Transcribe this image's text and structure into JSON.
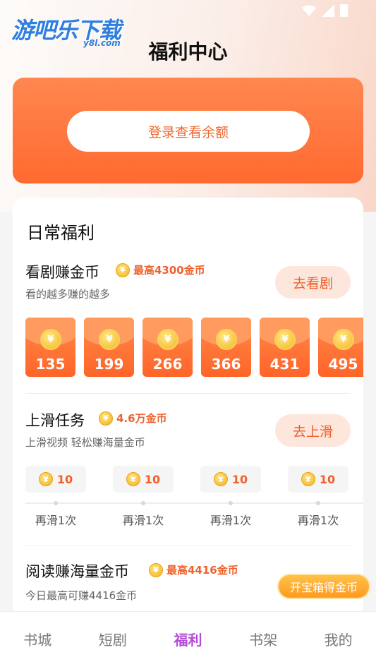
{
  "header": {
    "logo_text": "游吧乐下载",
    "logo_sub": "y8l.com",
    "title": "福利中心"
  },
  "balance": {
    "login_label": "登录查看余额"
  },
  "welfare": {
    "section_title": "日常福利",
    "coin_glyph": "¥",
    "drama_task": {
      "title": "看剧赚金币",
      "reward": "最高4300金币",
      "subtitle": "看的越多赚的越多",
      "button": "去看剧",
      "packets": [
        "135",
        "199",
        "266",
        "366",
        "431",
        "495"
      ]
    },
    "swipe_task": {
      "title": "上滑任务",
      "reward": "4.6万金币",
      "subtitle": "上滑视频 轻松赚海量金币",
      "button": "去上滑",
      "steps": [
        {
          "value": "10",
          "label": "再滑1次"
        },
        {
          "value": "10",
          "label": "再滑1次"
        },
        {
          "value": "10",
          "label": "再滑1次"
        },
        {
          "value": "10",
          "label": "再滑1次"
        }
      ]
    },
    "read_task": {
      "title": "阅读赚海量金币",
      "reward": "最高4416金币",
      "subtitle": "今日最高可赚4416金币"
    }
  },
  "floating": {
    "treasure_label": "开宝箱得金币"
  },
  "tabs": [
    {
      "label": "书城"
    },
    {
      "label": "短剧"
    },
    {
      "label": "福利"
    },
    {
      "label": "书架"
    },
    {
      "label": "我的"
    }
  ],
  "colors": {
    "accent": "#ff6a30",
    "active_tab": "#b44bd8",
    "reward_text": "#f0612c"
  }
}
